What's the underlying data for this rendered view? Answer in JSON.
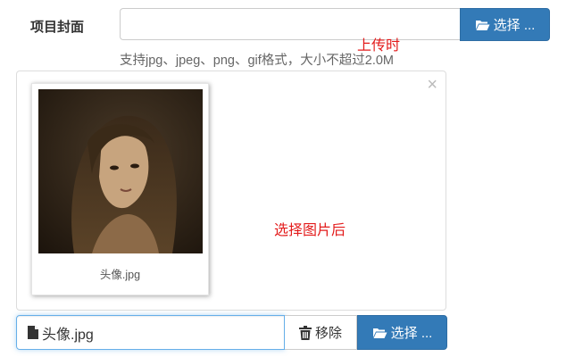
{
  "form": {
    "cover_label": "项目封面",
    "file_input_value": "",
    "select_button_label": "选择 ...",
    "hint_text": "支持jpg、jpeg、png、gif格式，大小不超过2.0M"
  },
  "annotations": {
    "upload_note": "上传时",
    "after_select_note": "选择图片后",
    "color": "#e31b1b"
  },
  "preview": {
    "close_symbol": "×",
    "thumbnail": {
      "caption": "头像.jpg",
      "icon": "portrait-photo"
    }
  },
  "file_bar": {
    "file_name": "头像.jpg",
    "file_icon": "file-icon",
    "remove_label": "移除",
    "remove_icon": "trash-icon",
    "select_label": "选择 ...",
    "select_icon": "folder-open-icon"
  },
  "colors": {
    "primary": "#337ab7",
    "focus_border": "#66afe9"
  }
}
